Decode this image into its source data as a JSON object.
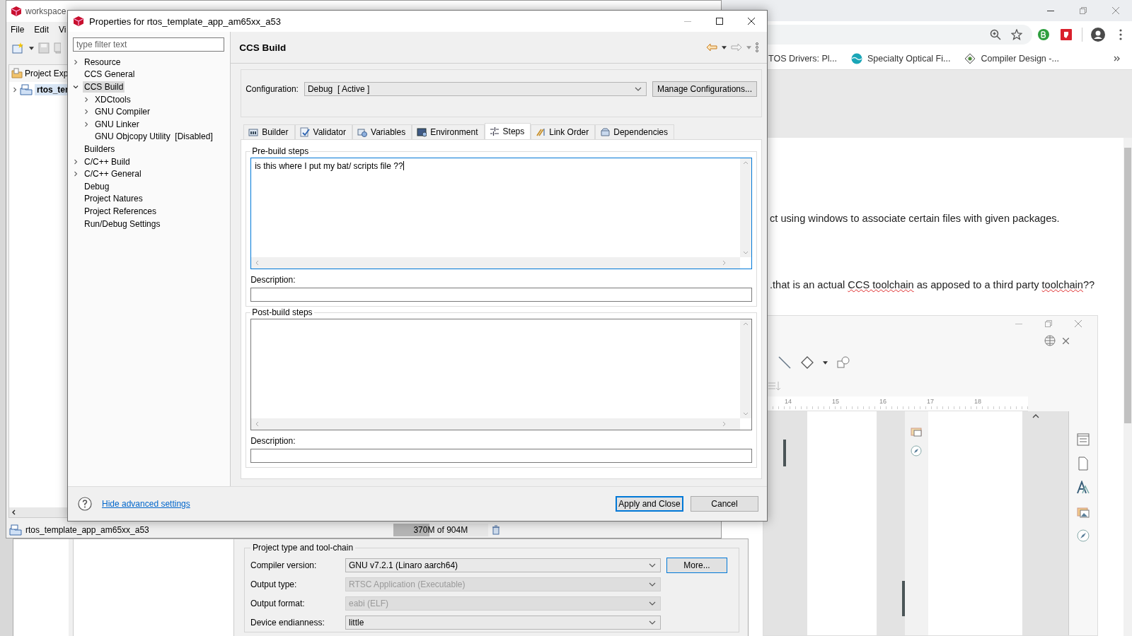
{
  "browser": {
    "bookmarks": [
      {
        "label": "TOS Drivers: Pl...",
        "kind": "plain"
      },
      {
        "label": "Specialty Optical Fi...",
        "kind": "globe"
      },
      {
        "label": "Compiler Design -...",
        "kind": "diamond"
      }
    ],
    "paragraphs": [
      [
        {
          "text": "ct using windows to associate certain files with given packages.",
          "misspelled": false
        }
      ],
      [
        {
          "text": ".that is an actual ",
          "misspelled": false
        },
        {
          "text": "CCS toolchain",
          "misspelled": true
        },
        {
          "text": " as apposed to a third party ",
          "misspelled": false
        },
        {
          "text": "toolchain",
          "misspelled": true
        },
        {
          "text": "??",
          "misspelled": false
        }
      ]
    ],
    "embedded_window": {
      "ruler_labels": [
        "14",
        "15",
        "16",
        "17",
        "18"
      ]
    }
  },
  "ide": {
    "title": "workspace",
    "menu": [
      "File",
      "Edit",
      "Vi"
    ],
    "explorer": {
      "tab": "Project Exp",
      "project": "rtos_ter"
    },
    "status": {
      "selection": "rtos_template_app_am65xx_a53",
      "heap": "370M of 904M",
      "level": 0.38
    }
  },
  "project_window": {
    "group": "Project type and tool-chain",
    "fields": [
      {
        "label": "Compiler version:",
        "value": "GNU v7.2.1 (Linaro aarch64)",
        "disabled": false
      },
      {
        "label": "Output type:",
        "value": "RTSC Application (Executable)",
        "disabled": true
      },
      {
        "label": "Output format:",
        "value": "eabi (ELF)",
        "disabled": true
      },
      {
        "label": "Device endianness:",
        "value": "little",
        "disabled": false
      }
    ],
    "more_button": "More..."
  },
  "dialog": {
    "title": "Properties for rtos_template_app_am65xx_a53",
    "filter_placeholder": "type filter text",
    "tree": [
      {
        "label": "Resource",
        "kind": "branch",
        "expanded": false,
        "selected": false
      },
      {
        "label": "CCS General",
        "kind": "leaf",
        "selected": false
      },
      {
        "label": "CCS Build",
        "kind": "branch",
        "expanded": true,
        "selected": true,
        "children": [
          {
            "label": "XDCtools",
            "kind": "branch",
            "expanded": false,
            "selected": false
          },
          {
            "label": "GNU Compiler",
            "kind": "branch",
            "expanded": false,
            "selected": false
          },
          {
            "label": "GNU Linker",
            "kind": "branch",
            "expanded": false,
            "selected": false
          },
          {
            "label": "GNU Objcopy Utility  [Disabled]",
            "kind": "leaf",
            "selected": false
          }
        ]
      },
      {
        "label": "Builders",
        "kind": "leaf",
        "selected": false
      },
      {
        "label": "C/C++ Build",
        "kind": "branch",
        "expanded": false,
        "selected": false
      },
      {
        "label": "C/C++ General",
        "kind": "branch",
        "expanded": false,
        "selected": false
      },
      {
        "label": "Debug",
        "kind": "leaf",
        "selected": false
      },
      {
        "label": "Project Natures",
        "kind": "leaf",
        "selected": false
      },
      {
        "label": "Project References",
        "kind": "leaf",
        "selected": false
      },
      {
        "label": "Run/Debug Settings",
        "kind": "leaf",
        "selected": false
      }
    ],
    "page_title": "CCS Build",
    "configuration": {
      "label": "Configuration:",
      "value": "Debug  [ Active ]",
      "button": "Manage Configurations..."
    },
    "tabs": [
      {
        "label": "Builder",
        "selected": false
      },
      {
        "label": "Validator",
        "selected": false
      },
      {
        "label": "Variables",
        "selected": false
      },
      {
        "label": "Environment",
        "selected": false
      },
      {
        "label": "Steps",
        "selected": true
      },
      {
        "label": "Link Order",
        "selected": false
      },
      {
        "label": "Dependencies",
        "selected": false
      }
    ],
    "step_groups": [
      {
        "title": "Pre-build steps",
        "value": "is this where I put my bat/ scripts file ??",
        "focused": true,
        "description_label": "Description:"
      },
      {
        "title": "Post-build steps",
        "focused": false,
        "description_label": "Description:"
      }
    ],
    "link": "Hide advanced settings",
    "buttons": [
      {
        "label": "Apply and Close",
        "default": true
      },
      {
        "label": "Cancel",
        "default": false
      }
    ]
  }
}
